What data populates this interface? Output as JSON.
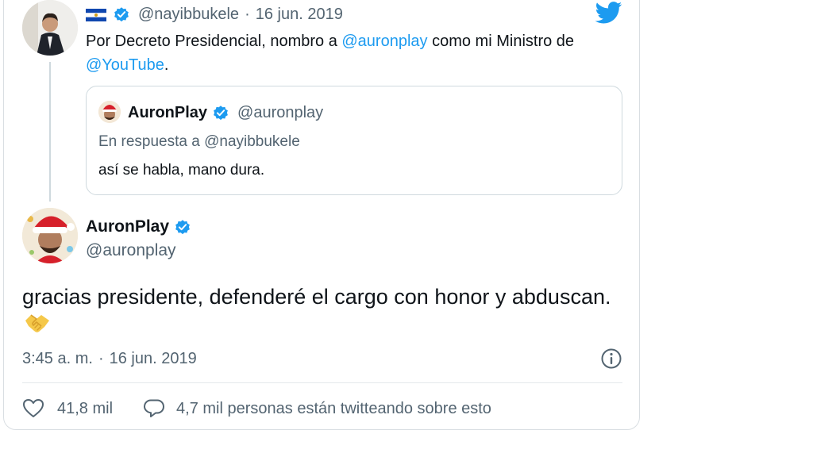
{
  "first_tweet": {
    "handle": "@nayibbukele",
    "separator": "·",
    "date": "16 jun. 2019",
    "text_before": "Por Decreto Presidencial, nombro a ",
    "mention_1": "@auronplay",
    "text_middle": " como mi Ministro de",
    "mention_2": "@YouTube",
    "text_after": "."
  },
  "quoted_tweet": {
    "name": "AuronPlay",
    "handle": "@auronplay",
    "reply_prefix": "En respuesta a ",
    "reply_to": "@nayibbukele",
    "text": "así se habla, mano dura."
  },
  "main_tweet": {
    "name": "AuronPlay",
    "handle": "@auronplay",
    "text": "gracias presidente, defenderé el cargo con honor y abduscan.",
    "emoji_icon": "handshake-emoji",
    "time": "3:45 a. m.",
    "separator": "·",
    "date": "16 jun. 2019"
  },
  "actions": {
    "likes": "41,8 mil",
    "reply_info": "4,7 mil personas están twitteando sobre esto"
  },
  "icons": [
    "el-salvador-flag-icon",
    "verified-icon",
    "twitter-bird-icon",
    "info-icon",
    "heart-icon",
    "reply-bubble-icon"
  ],
  "colors": {
    "accent": "#1d9bf0",
    "secondary_text": "#536471",
    "border": "#cfd9de"
  }
}
